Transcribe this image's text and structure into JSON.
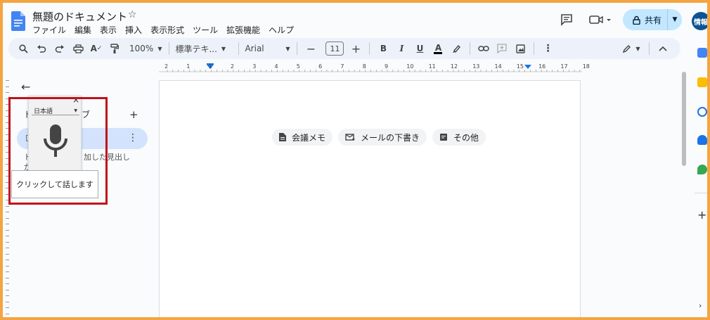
{
  "document": {
    "title": "無題のドキュメント"
  },
  "menu": {
    "items": [
      "ファイル",
      "編集",
      "表示",
      "挿入",
      "表示形式",
      "ツール",
      "拡張機能",
      "ヘルプ"
    ]
  },
  "header": {
    "share_label": "共有",
    "avatar_text": "情報"
  },
  "toolbar": {
    "zoom": "100%",
    "style": "標準テキ...",
    "font": "Arial",
    "font_size": "11"
  },
  "ruler": {
    "numbers": [
      "2",
      "1",
      "1",
      "2",
      "3",
      "4",
      "5",
      "6",
      "7",
      "8",
      "9",
      "10",
      "11",
      "12",
      "13",
      "14",
      "15",
      "16",
      "17",
      "18"
    ]
  },
  "page": {
    "chips": [
      {
        "label": "会議メモ",
        "icon": "document-icon"
      },
      {
        "label": "メールの下書き",
        "icon": "email-draft-icon"
      },
      {
        "label": "その他",
        "icon": "more-templates-icon"
      }
    ]
  },
  "outline": {
    "heading_fragment": "ド",
    "heading_fragment_end": "ブ",
    "hint_line1": "ド",
    "hint_line1_end": "加した見出しがこ",
    "hint_line2": "こ"
  },
  "voice": {
    "language": "日本語",
    "tooltip": "クリックして話します"
  },
  "colors": {
    "accent": "#c2e7ff",
    "highlight": "#c0121b",
    "doc_blue": "#4285f4"
  }
}
